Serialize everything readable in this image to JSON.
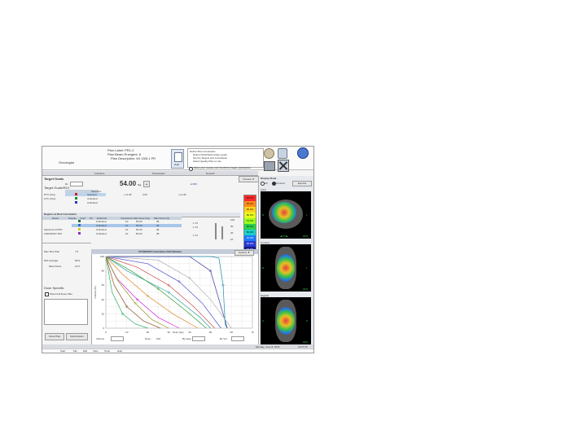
{
  "header": {
    "lines": [
      "Plan Label: PR1-2",
      "Plan Beam Energies: 6",
      "Plan Description: 6X 15/5.1 PR"
    ],
    "left_label": "Oncologist"
  },
  "toolbar": {
    "help_label": "Help",
    "info_lines": [
      "Define Plan Constraints",
      "Define ROIs/Optimization goals",
      "Set the Targets and Constraints",
      "Select Quality Plan to Use"
    ],
    "radio_label": "Move your mouse over the ROI to begin optimization"
  },
  "top_fields": [
    "Fractions",
    "Prescription",
    "Dose/Fr"
  ],
  "target_section": {
    "title": "Target Goals",
    "dose_value": "54.00",
    "dose_unit": "Gy",
    "column_header": "Target Goals/ROI",
    "checkbox_header": "Selected",
    "rows": [
      {
        "name": "PTV (cGy)",
        "status": "Selected"
      },
      {
        "name": "GTV (cGy)",
        "status": "Unlimited"
      },
      {
        "name": "",
        "status": "Unlimited"
      }
    ],
    "values": [
      "+/-0.45",
      "3.00",
      "+/-0.45"
    ],
    "presets_label": "Presets"
  },
  "risk_section": {
    "title": "Regions at Risk Constraints",
    "columns": [
      "Name",
      "Display",
      "Color",
      "Ptr",
      "Enforced",
      "Importance",
      "Max Dose (Gy)",
      "Max Dose (%)"
    ],
    "rows": [
      {
        "name": "",
        "color": "#1d7a2f",
        "status": "Unlimited",
        "imp": "10",
        "max": "50.00",
        "pct": "38"
      },
      {
        "name": "",
        "color": "#2d6fb8",
        "status": "Unlimited",
        "imp": "10",
        "max": "50.00",
        "pct": "38"
      },
      {
        "name": "Spinal Cord PRV",
        "color": "#d9c21b",
        "status": "Unlimited",
        "imp": "10",
        "max": "50.00",
        "pct": "38"
      },
      {
        "name": "OAR BODY ROI",
        "color": "#8a2fb8",
        "status": "Unlimited",
        "imp": "10",
        "max": "50.00",
        "pct": "38"
      }
    ],
    "mid_values": [
      "1.73",
      "1.73",
      "1.73"
    ],
    "side_values": [
      "100",
      "50",
      "20",
      "10"
    ]
  },
  "side_panel": {
    "labels": [
      "Max Size Plan",
      "ROI Average",
      "Mean Dose"
    ],
    "values": [
      "7.5",
      "50%",
      "12.5"
    ],
    "dose_specific": "Dose Specific",
    "checkbox_label": "Show Full Dose Plan",
    "buttons": [
      "Close Plan",
      "Optimization"
    ]
  },
  "chart": {
    "title": "STANDARD Cumulative DVH Relative",
    "options_label": "Options",
    "xlabel": "Dose (Gy)",
    "ylabel": "Volume (%)",
    "xticks": [
      "0",
      "10",
      "20",
      "30",
      "40",
      "50",
      "60",
      "70"
    ],
    "yticks": [
      "0",
      "20",
      "40",
      "60",
      "80",
      "100"
    ],
    "footer_fields": [
      "Volume",
      "Dose",
      "By dose",
      "By Vol"
    ],
    "footer_values": [
      "100",
      "0",
      "0",
      "70"
    ]
  },
  "chart_data": {
    "type": "line",
    "title": "STANDARD Cumulative DVH Relative",
    "xlabel": "Dose (Gy)",
    "ylabel": "Volume (%)",
    "xlim": [
      0,
      70
    ],
    "ylim": [
      0,
      100
    ],
    "grid": true,
    "series": [
      {
        "color": "#1a8fb0",
        "x": [
          0,
          50,
          54,
          56,
          57,
          58
        ],
        "y": [
          100,
          100,
          98,
          60,
          5,
          0
        ]
      },
      {
        "color": "#3a3aa0",
        "x": [
          0,
          40,
          50,
          55,
          58
        ],
        "y": [
          100,
          100,
          80,
          30,
          0
        ]
      },
      {
        "color": "#2aa0a0",
        "x": [
          0,
          10,
          30,
          45,
          50
        ],
        "y": [
          100,
          80,
          50,
          15,
          0
        ]
      },
      {
        "color": "#d020d0",
        "x": [
          0,
          5,
          15,
          25,
          35
        ],
        "y": [
          100,
          70,
          40,
          15,
          0
        ]
      },
      {
        "color": "#e08020",
        "x": [
          0,
          8,
          20,
          32,
          44
        ],
        "y": [
          100,
          75,
          45,
          20,
          0
        ]
      },
      {
        "color": "#2a9a2a",
        "x": [
          0,
          12,
          25,
          38,
          48
        ],
        "y": [
          100,
          80,
          55,
          25,
          0
        ]
      },
      {
        "color": "#8a5a2a",
        "x": [
          0,
          4,
          10,
          18,
          26
        ],
        "y": [
          100,
          60,
          30,
          10,
          0
        ]
      },
      {
        "color": "#d05050",
        "x": [
          0,
          15,
          30,
          42,
          52
        ],
        "y": [
          100,
          85,
          60,
          30,
          0
        ]
      },
      {
        "color": "#909020",
        "x": [
          0,
          6,
          14,
          22,
          30
        ],
        "y": [
          100,
          65,
          35,
          12,
          0
        ]
      },
      {
        "color": "#5050d0",
        "x": [
          0,
          20,
          35,
          46,
          55
        ],
        "y": [
          100,
          90,
          65,
          35,
          0
        ]
      },
      {
        "color": "#20b060",
        "x": [
          0,
          3,
          8,
          14,
          20
        ],
        "y": [
          100,
          50,
          20,
          6,
          0
        ]
      },
      {
        "color": "#b0b0b0",
        "x": [
          0,
          25,
          40,
          50,
          60
        ],
        "y": [
          100,
          95,
          70,
          40,
          0
        ]
      }
    ]
  },
  "display_panel": {
    "title": "Display Mode",
    "options": [
      "2D",
      "Coronal"
    ],
    "button": "Expand",
    "scale_values": [
      "98.4%",
      "95.0%",
      "90.0%",
      "80.0%",
      "70.0%",
      "60.0%",
      "50.0%",
      "40.0%",
      "30.0%",
      "20.0%"
    ],
    "scale_colors": [
      "#ff2a2a",
      "#ff8c1a",
      "#ffd21a",
      "#e6ff1a",
      "#9aff1a",
      "#2ad14a",
      "#1ad1c8",
      "#1a7aff",
      "#2a3ad1",
      "#1a1a8a"
    ],
    "views": [
      {
        "label": "Axial",
        "orient_left": "R",
        "orient_right": "L",
        "slice": "27",
        "tag": "HFS"
      },
      {
        "label": "Coronal",
        "orient_left": "R",
        "orient_right": "L",
        "slice": "",
        "tag": "HFS"
      },
      {
        "label": "Sagittal",
        "orient_left": "A",
        "orient_right": "P",
        "slice": "",
        "tag": "HFS"
      }
    ]
  },
  "status_bar": {
    "date": "Monday, June 8, 2015",
    "time": "19:57:25"
  },
  "taskbar": {
    "items": [
      "Start",
      "File",
      "Edit",
      "View",
      "Tools",
      "Help"
    ]
  }
}
